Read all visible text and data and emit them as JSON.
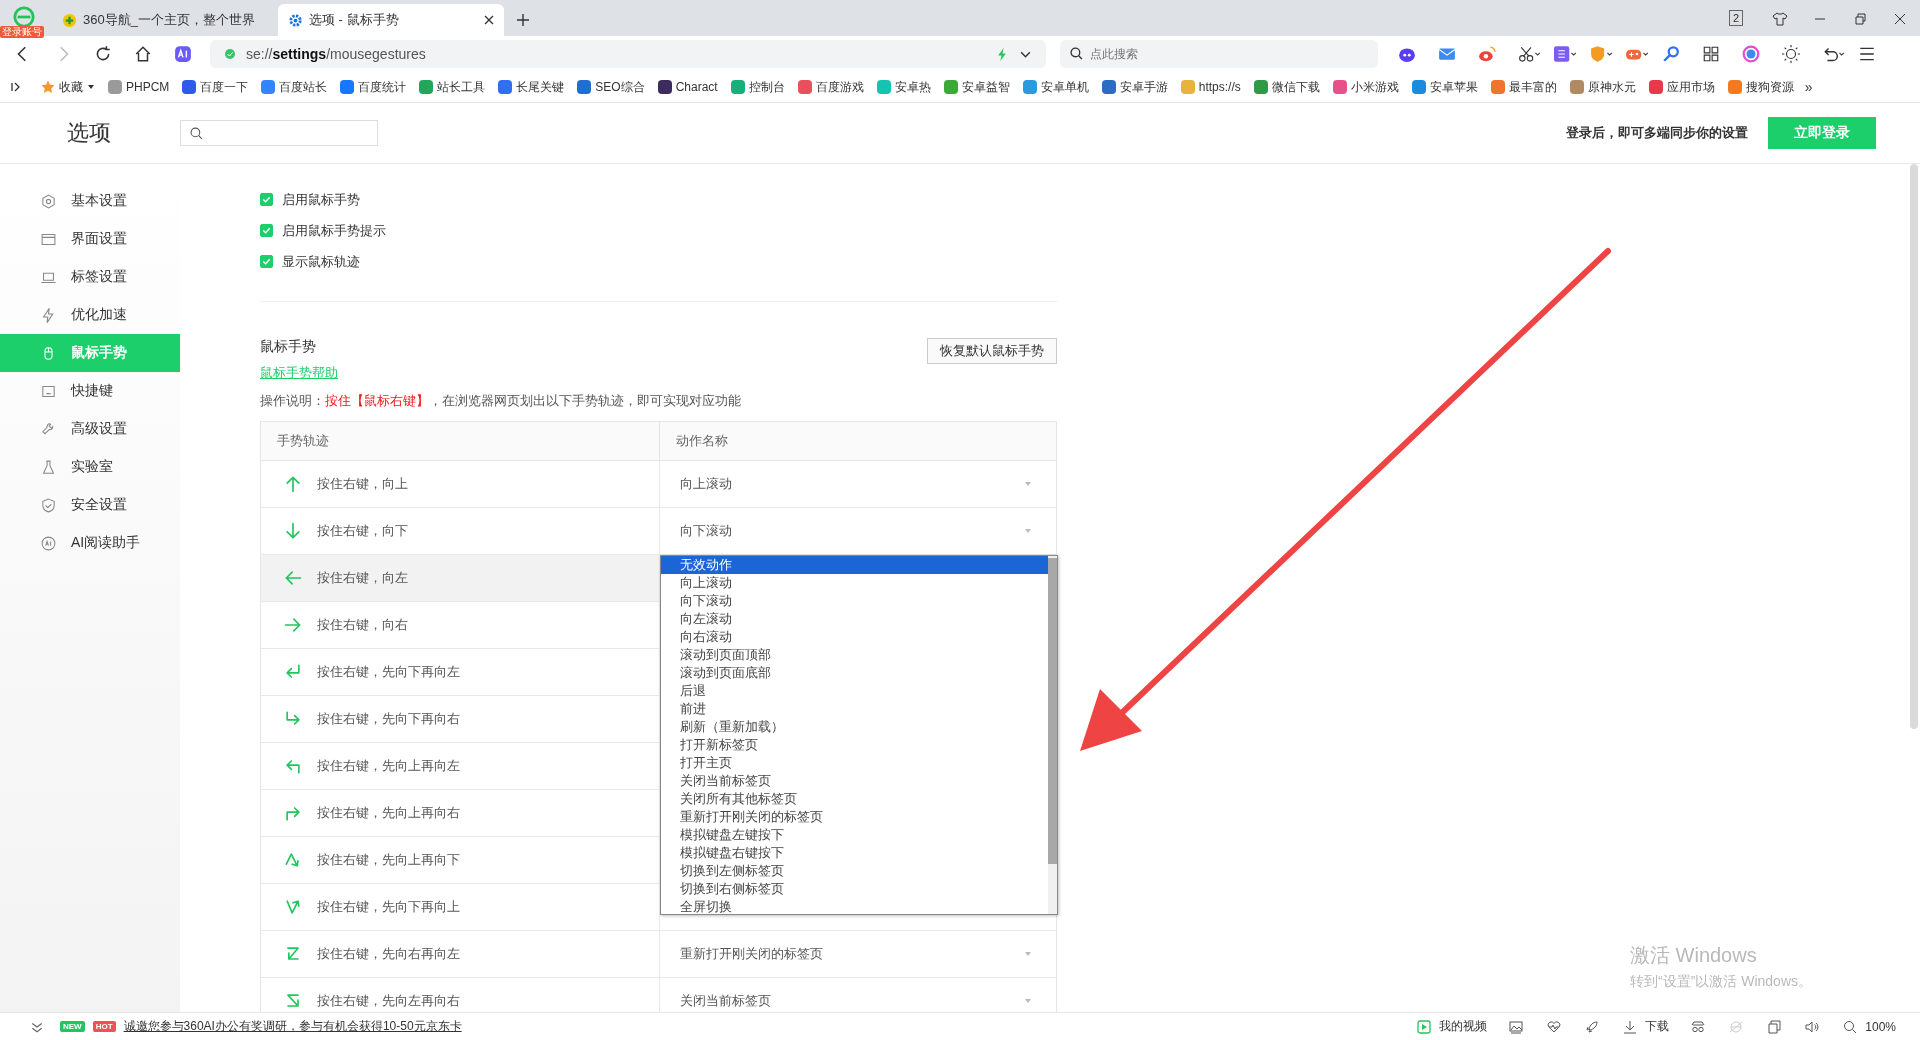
{
  "browser": {
    "account_badge": "登录账号",
    "tabs": [
      {
        "title": "360导航_一个主页，整个世界",
        "kind": "home",
        "selected": false
      },
      {
        "title": "选项 - 鼠标手势",
        "kind": "settings",
        "selected": true
      }
    ],
    "window_count": "2",
    "address": "se://**settings**/mousegestures",
    "search": {
      "placeholder": "点此搜索"
    }
  },
  "bookmarks": [
    {
      "label": "收藏",
      "color": "#f59a23"
    },
    {
      "label": "PHPCM",
      "color": "#9a9a9a"
    },
    {
      "label": "百度一下",
      "color": "#2f5bea"
    },
    {
      "label": "百度站长",
      "color": "#3385ff"
    },
    {
      "label": "百度统计",
      "color": "#1677ff"
    },
    {
      "label": "站长工具",
      "color": "#21a65b"
    },
    {
      "label": "长尾关键",
      "color": "#2f6ff0"
    },
    {
      "label": "SEO综合",
      "color": "#1f6fd0"
    },
    {
      "label": "Charact",
      "color": "#3b2b5e"
    },
    {
      "label": "控制台",
      "color": "#18b07a"
    },
    {
      "label": "百度游戏",
      "color": "#e8505b"
    },
    {
      "label": "安卓热",
      "color": "#14c4b0"
    },
    {
      "label": "安卓益智",
      "color": "#3aa936"
    },
    {
      "label": "安卓单机",
      "color": "#2a9be0"
    },
    {
      "label": "安卓手游",
      "color": "#2b6cc4"
    },
    {
      "label": "https://s",
      "color": "#e6b43c"
    },
    {
      "label": "微信下载",
      "color": "#2e9a47"
    },
    {
      "label": "小米游戏",
      "color": "#e8508c"
    },
    {
      "label": "安卓苹果",
      "color": "#1a8ce0"
    },
    {
      "label": "最丰富的",
      "color": "#f0742a"
    },
    {
      "label": "原神水元",
      "color": "#b08a60"
    },
    {
      "label": "应用市场",
      "color": "#e8384a"
    },
    {
      "label": "搜狗资源",
      "color": "#f57a1f"
    }
  ],
  "bookmarks_more": "»",
  "header": {
    "title": "选项",
    "login_hint": "登录后，即可多端同步你的设置",
    "login_button": "立即登录"
  },
  "sidebar": [
    {
      "label": "基本设置",
      "kind": "basic",
      "selected": false
    },
    {
      "label": "界面设置",
      "kind": "ui",
      "selected": false
    },
    {
      "label": "标签设置",
      "kind": "tab",
      "selected": false
    },
    {
      "label": "优化加速",
      "kind": "speed",
      "selected": false
    },
    {
      "label": "鼠标手势",
      "kind": "mouse",
      "selected": true
    },
    {
      "label": "快捷键",
      "kind": "keys",
      "selected": false
    },
    {
      "label": "高级设置",
      "kind": "advanced",
      "selected": false
    },
    {
      "label": "实验室",
      "kind": "lab",
      "selected": false
    },
    {
      "label": "安全设置",
      "kind": "security",
      "selected": false
    },
    {
      "label": "AI阅读助手",
      "kind": "ai",
      "selected": false
    }
  ],
  "options": [
    {
      "label": "启用鼠标手势",
      "checked": true
    },
    {
      "label": "启用鼠标手势提示",
      "checked": true
    },
    {
      "label": "显示鼠标轨迹",
      "checked": true
    }
  ],
  "gestures": {
    "title": "鼠标手势",
    "reset_button": "恢复默认鼠标手势",
    "help_link": "鼠标手势帮助",
    "note": [
      "操作说明：",
      "按住【鼠标右键】",
      "，在浏览器网页划出以下手势轨迹，即可实现对应功能"
    ],
    "columns": [
      "手势轨迹",
      "动作名称"
    ],
    "rows": [
      {
        "kind": "up",
        "label": "按住右键，向上",
        "action": "向上滚动",
        "hovered": false
      },
      {
        "kind": "down",
        "label": "按住右键，向下",
        "action": "向下滚动",
        "hovered": false
      },
      {
        "kind": "left",
        "label": "按住右键，向左",
        "hovered": true
      },
      {
        "kind": "right",
        "label": "按住右键，向右",
        "hovered": false
      },
      {
        "kind": "down-left",
        "label": "按住右键，先向下再向左",
        "hovered": false
      },
      {
        "kind": "down-right",
        "label": "按住右键，先向下再向右",
        "hovered": false
      },
      {
        "kind": "up-left",
        "label": "按住右键，先向上再向左",
        "hovered": false
      },
      {
        "kind": "up-right",
        "label": "按住右键，先向上再向右",
        "hovered": false
      },
      {
        "kind": "up-down",
        "label": "按住右键，先向上再向下",
        "hovered": false
      },
      {
        "kind": "down-up",
        "label": "按住右键，先向下再向上",
        "hovered": false
      },
      {
        "kind": "right-left",
        "label": "按住右键，先向右再向左",
        "action": "重新打开刚关闭的标签页",
        "hovered": false
      },
      {
        "kind": "left-right",
        "label": "按住右键，先向左再向右",
        "action": "关闭当前标签页",
        "hovered": false
      }
    ],
    "dropdown": [
      {
        "label": "无效动作",
        "selected": true
      },
      {
        "label": "向上滚动",
        "selected": false
      },
      {
        "label": "向下滚动",
        "selected": false
      },
      {
        "label": "向左滚动",
        "selected": false
      },
      {
        "label": "向右滚动",
        "selected": false
      },
      {
        "label": "滚动到页面顶部",
        "selected": false
      },
      {
        "label": "滚动到页面底部",
        "selected": false
      },
      {
        "label": "后退",
        "selected": false
      },
      {
        "label": "前进",
        "selected": false
      },
      {
        "label": "刷新（重新加载）",
        "selected": false
      },
      {
        "label": "打开新标签页",
        "selected": false
      },
      {
        "label": "打开主页",
        "selected": false
      },
      {
        "label": "关闭当前标签页",
        "selected": false
      },
      {
        "label": "关闭所有其他标签页",
        "selected": false
      },
      {
        "label": "重新打开刚关闭的标签页",
        "selected": false
      },
      {
        "label": "模拟键盘左键按下",
        "selected": false
      },
      {
        "label": "模拟键盘右键按下",
        "selected": false
      },
      {
        "label": "切换到左侧标签页",
        "selected": false
      },
      {
        "label": "切换到右侧标签页",
        "selected": false
      },
      {
        "label": "全屏切换",
        "selected": false
      }
    ]
  },
  "status_bar": {
    "badges": [
      {
        "label": "NEW",
        "color": "#22c55e"
      },
      {
        "label": "HOT",
        "color": "#f0505a"
      }
    ],
    "notice": "诚邀您参与360AI办公有奖调研，参与有机会获得10-50元京东卡",
    "video": "我的视频",
    "download": "下载",
    "zoom": "100%"
  },
  "os_watermark": {
    "title": "激活 Windows",
    "subtitle": "转到“设置”以激活 Windows。"
  }
}
